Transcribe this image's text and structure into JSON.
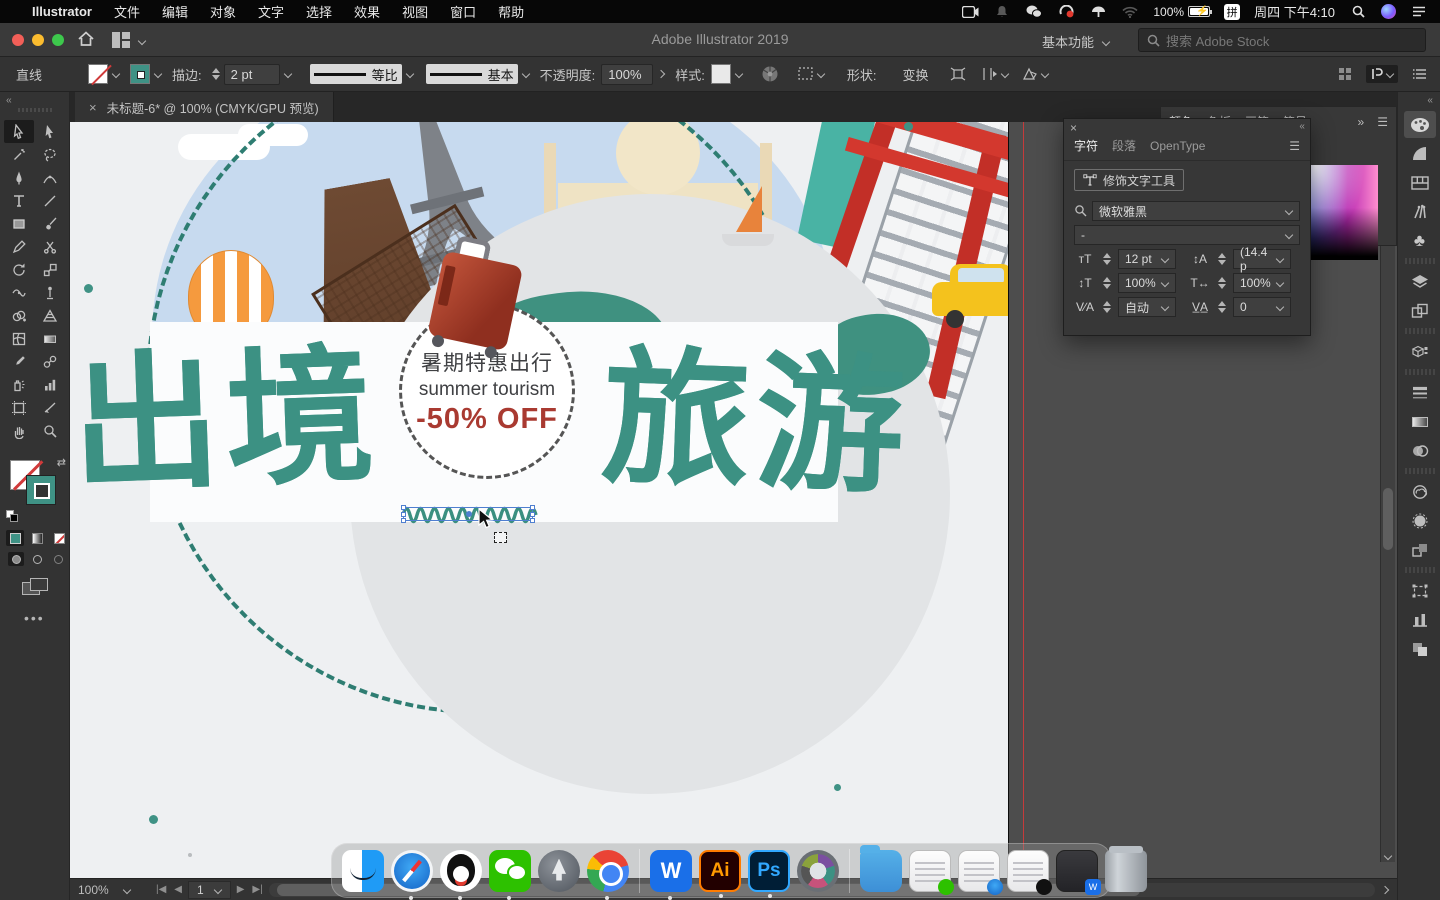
{
  "menu_bar": {
    "items": [
      "Illustrator",
      "文件",
      "编辑",
      "对象",
      "文字",
      "选择",
      "效果",
      "视图",
      "窗口",
      "帮助"
    ],
    "battery": "100%",
    "input_method": "拼",
    "clock": "周四 下午4:10",
    "status_icons": [
      "screen-record-icon",
      "notification-bell-icon",
      "wechat-status-icon",
      "drive-status-icon",
      "vpn-status-icon",
      "wifi-icon",
      "battery-icon",
      "input-method-badge",
      "spotlight-icon",
      "siri-icon",
      "notification-center-icon"
    ]
  },
  "title_bar": {
    "title": "Adobe Illustrator 2019",
    "workspace": "基本功能",
    "stock_search_placeholder": "搜索 Adobe Stock"
  },
  "control_bar": {
    "tool_name": "直线",
    "stroke_label": "描边:",
    "stroke_weight": "2 pt",
    "width_profile": "等比",
    "brush_definition": "基本",
    "opacity_label": "不透明度:",
    "opacity_value": "100%",
    "style_label": "样式:",
    "shape_label": "形状:",
    "transform_label": "变换"
  },
  "document": {
    "tab_title": "未标题-6* @ 100% (CMYK/GPU 预览)",
    "zoom_level": "100%",
    "artboard_number": "1"
  },
  "artwork": {
    "headline_left": "出境",
    "headline_right": "旅游",
    "badge": {
      "line1": "暑期特惠出行",
      "line2": "summer tourism",
      "line3": "-50% OFF"
    }
  },
  "character_panel": {
    "tabs": [
      "字符",
      "段落",
      "OpenType"
    ],
    "touch_type_button": "修饰文字工具",
    "font_family": "微软雅黑",
    "font_style": "-",
    "font_size": "12 pt",
    "leading": "(14.4 p",
    "vertical_scale": "100%",
    "horizontal_scale": "100%",
    "kerning": "自动",
    "tracking": "0"
  },
  "color_panel": {
    "tabs": [
      "颜色",
      "色板",
      "画笔",
      "符号"
    ]
  },
  "left_toolbar_tools": [
    "direct-selection",
    "selection",
    "magic-wand",
    "lasso",
    "pen",
    "curvature",
    "type",
    "line-segment",
    "rectangle",
    "paintbrush",
    "pencil",
    "scissors",
    "rotate",
    "scale",
    "width",
    "puppet-warp",
    "shape-builder",
    "perspective-grid",
    "mesh",
    "gradient",
    "eyedropper",
    "blend",
    "symbol-sprayer",
    "column-graph",
    "artboard",
    "slice",
    "hand",
    "zoom"
  ],
  "right_strip_panels": [
    "color",
    "color-guide",
    "swatches",
    "brushes",
    "symbols",
    "layers",
    "artboards",
    "asset-export",
    "stroke",
    "gradient",
    "transparency",
    "cc-libraries",
    "image-trace",
    "links",
    "transform",
    "align",
    "pathfinder"
  ],
  "dock_apps": [
    "finder",
    "safari",
    "qq",
    "wechat",
    "launchpad",
    "chrome",
    "wps-office",
    "illustrator",
    "photoshop",
    "video-player",
    "downloads-folder",
    "minimized-document",
    "minimized-browser-window",
    "minimized-list-window",
    "minimized-dark-window",
    "trash"
  ],
  "colors": {
    "teal": "#3F9285",
    "badge_red": "#A93A31",
    "artboard": "#EEF0F2",
    "dome_blue": "#C7DAEF"
  }
}
